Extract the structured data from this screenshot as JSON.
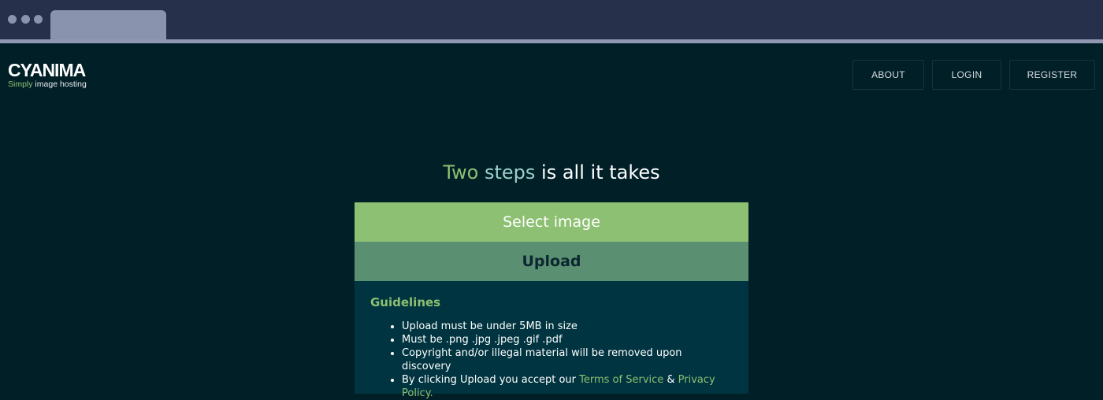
{
  "browser": {
    "tab_title": ""
  },
  "header": {
    "logo_text": "CYANIMA",
    "tagline_accent": "Simply",
    "tagline_rest": " image hosting",
    "nav": {
      "about": "ABOUT",
      "login": "LOGIN",
      "register": "REGISTER"
    }
  },
  "hero": {
    "headline_part1": "Two",
    "headline_part2": "steps",
    "headline_part3": "is all it takes"
  },
  "upload_panel": {
    "select_label": "Select image",
    "upload_label": "Upload",
    "guidelines_title": "Guidelines",
    "rules": [
      "Upload must be under 5MB in size",
      "Must be .png .jpg .jpeg .gif .pdf",
      "Copyright and/or illegal material will be removed upon discovery"
    ],
    "consent_prefix": "By clicking Upload you accept our ",
    "terms_link": "Terms of Service",
    "consent_joiner": " & ",
    "privacy_link": "Privacy Policy."
  },
  "colors": {
    "page_background": "#011f27",
    "accent_green": "#8dc072",
    "upload_green": "#5a8f71",
    "panel_background": "#003440"
  }
}
